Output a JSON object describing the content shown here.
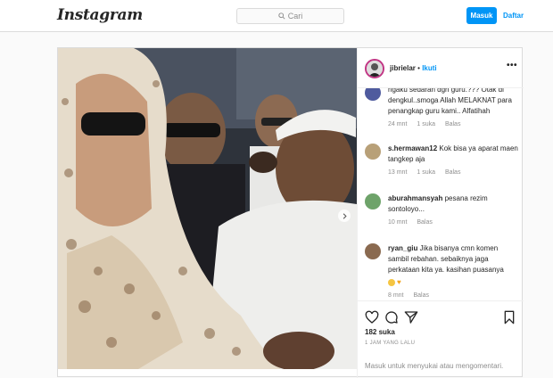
{
  "header": {
    "logo": "Instagram",
    "search_placeholder": "Cari",
    "login_label": "Masuk",
    "signup_label": "Daftar"
  },
  "post": {
    "username": "jibrielar",
    "separator": "•",
    "follow_label": "Ikuti",
    "more_label": "•••",
    "comments": [
      {
        "username": "",
        "text": "ngaku sedaran dgn guru.??? Otak di dengkul..smoga Allah MELAKNAT para penangkap guru kami.. Alfatihah",
        "time": "24 mnt",
        "likes": "1 suka",
        "reply": "Balas"
      },
      {
        "username": "s.hermawan12",
        "text": "Kok bisa ya aparat maen tangkep aja",
        "time": "13 mnt",
        "likes": "1 suka",
        "reply": "Balas"
      },
      {
        "username": "aburahmansyah",
        "text": "pesana rezim sontoloyo...",
        "time": "10 mnt",
        "likes": "",
        "reply": "Balas"
      },
      {
        "username": "ryan_giu",
        "text": "Jika bisanya cmn komen sambil rebahan. sebaiknya jaga perkataan kita ya. kasihan puasanya",
        "time": "8 mnt",
        "likes": "",
        "reply": "Balas"
      }
    ],
    "like_count": "182 suka",
    "timestamp": "1 JAM YANG LALU",
    "add_comment_placeholder": "Masuk untuk menyukai atau mengomentari."
  },
  "colors": {
    "accent": "#0095f6",
    "border": "#dbdbdb",
    "muted": "#8e8e8e"
  },
  "icons": [
    "search-icon",
    "heart-icon",
    "comment-icon",
    "share-icon",
    "bookmark-icon",
    "chevron-right-icon"
  ]
}
